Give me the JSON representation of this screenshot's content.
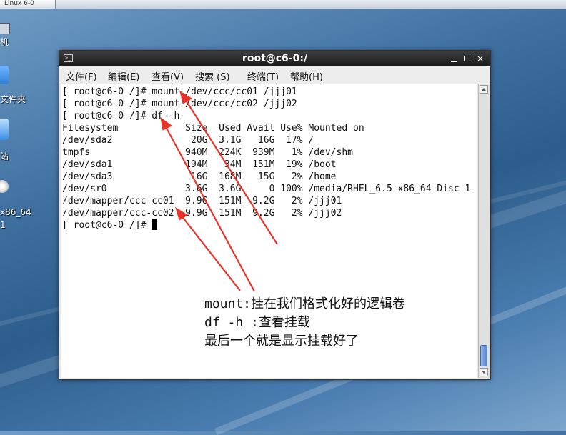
{
  "background_window": {
    "tab_label": "Linux 6-0"
  },
  "desktop": {
    "icons": [
      {
        "name": "computer",
        "label": "机"
      },
      {
        "name": "folder",
        "label": "文件夹"
      },
      {
        "name": "trash",
        "label": "站"
      },
      {
        "name": "disc",
        "label": "x86_64",
        "label2": "1"
      }
    ]
  },
  "window": {
    "title": "root@c6-0:/",
    "icon": "terminal-icon",
    "controls": [
      "minimize-icon",
      "maximize-icon",
      "close-icon"
    ],
    "close_glyph": "×"
  },
  "menu": {
    "items": [
      "文件(F)",
      "编辑(E)",
      "查看(V)",
      "搜索 (S)",
      "终端(T)",
      "帮助(H)"
    ]
  },
  "terminal": {
    "lines": [
      "[ root@c6-0 /]# mount /dev/ccc/cc01 /jjj01",
      "[ root@c6-0 /]# mount /dev/ccc/cc02 /jjj02",
      "[ root@c6-0 /]# df -h",
      "Filesystem            Size  Used Avail Use% Mounted on",
      "/dev/sda2              20G  3.1G   16G  17% /",
      "tmpfs                 940M  224K  939M   1% /dev/shm",
      "/dev/sda1             194M   34M  151M  19% /boot",
      "/dev/sda3              16G  168M   15G   2% /home",
      "/dev/sr0              3.6G  3.6G     0 100% /media/RHEL_6.5 x86_64 Disc 1",
      "/dev/mapper/ccc-cc01  9.9G  151M  9.2G   2% /jjj01",
      "/dev/mapper/ccc-cc02  9.9G  151M  9.2G   2% /jjj02"
    ],
    "prompt": "[ root@c6-0 /]# "
  },
  "annotation": {
    "line1": "mount:挂在我们格式化好的逻辑卷",
    "line2": "df -h :查看挂载",
    "line3": "最后一个就是显示挂载好了",
    "arrow_color": "#e8332a"
  }
}
